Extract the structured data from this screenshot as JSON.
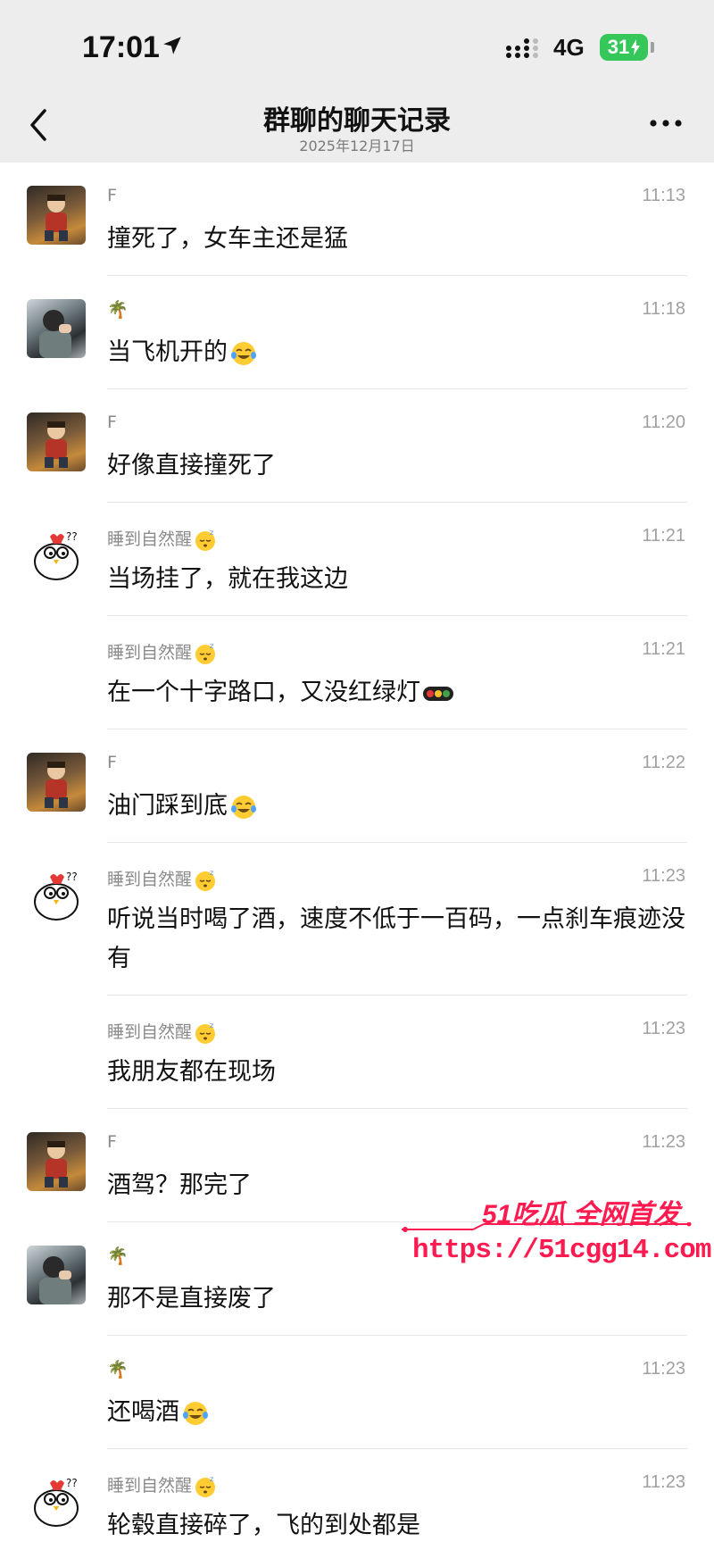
{
  "status_bar": {
    "time": "17:01",
    "network": "4G",
    "battery": "31"
  },
  "header": {
    "title": "群聊的聊天记录",
    "date": "2025年12月17日"
  },
  "messages": [
    {
      "sender": "F",
      "time": "11:13",
      "text": "撞死了，女车主还是猛",
      "avatar": "f"
    },
    {
      "sender": "🌴",
      "time": "11:18",
      "text": "当飞机开的",
      "avatar": "tree",
      "emoji": "crying-laughing"
    },
    {
      "sender": "F",
      "time": "11:20",
      "text": "好像直接撞死了",
      "avatar": "f"
    },
    {
      "sender": "睡到自然醒",
      "time": "11:21",
      "text": "当场挂了，就在我这边",
      "avatar": "chick",
      "sender_emoji": "sleeping"
    },
    {
      "sender": "睡到自然醒",
      "time": "11:21",
      "text": "在一个十字路口，又没红绿灯",
      "avatar": "",
      "sender_emoji": "sleeping",
      "emoji": "traffic-light"
    },
    {
      "sender": "F",
      "time": "11:22",
      "text": "油门踩到底",
      "avatar": "f",
      "emoji": "crying-laughing"
    },
    {
      "sender": "睡到自然醒",
      "time": "11:23",
      "text": "听说当时喝了酒，速度不低于一百码，一点刹车痕迹没有",
      "avatar": "chick",
      "sender_emoji": "sleeping"
    },
    {
      "sender": "睡到自然醒",
      "time": "11:23",
      "text": "我朋友都在现场",
      "avatar": "",
      "sender_emoji": "sleeping"
    },
    {
      "sender": "F",
      "time": "11:23",
      "text": "酒驾？那完了",
      "avatar": "f"
    },
    {
      "sender": "🌴",
      "time": "",
      "text": "那不是直接废了",
      "avatar": "tree"
    },
    {
      "sender": "🌴",
      "time": "11:23",
      "text": "还喝酒",
      "avatar": "",
      "emoji": "tears-of-joy"
    },
    {
      "sender": "睡到自然醒",
      "time": "11:23",
      "text": "轮毂直接碎了，飞的到处都是",
      "avatar": "chick",
      "sender_emoji": "sleeping"
    }
  ],
  "watermark": {
    "brand": "51吃瓜 全网首发",
    "url": "https://51cgg14.com"
  },
  "colors": {
    "header_bg": "#ededed",
    "watermark": "#ff1a4f",
    "battery": "#35c759"
  }
}
